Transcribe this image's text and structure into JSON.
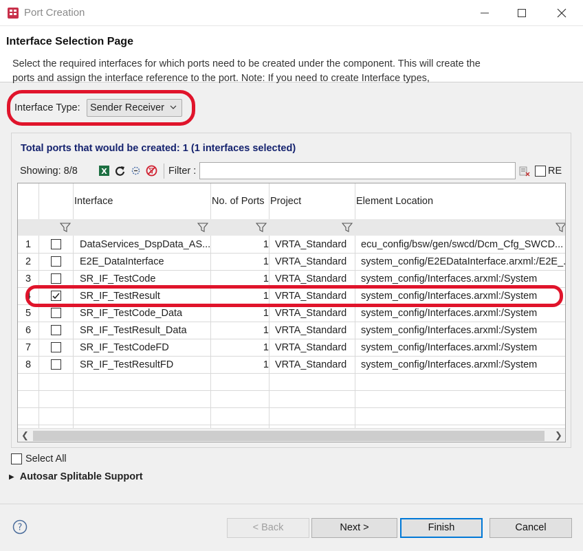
{
  "window": {
    "title": "Port Creation"
  },
  "page": {
    "title": "Interface Selection Page",
    "description": "Select the required interfaces for which ports need to be created under the component. This will create the ports and assign the interface reference to the port. Note: If you need to create Interface types,"
  },
  "interface_type": {
    "label": "Interface Type:",
    "selected": "Sender Receiver"
  },
  "summary": {
    "total_ports": "Total ports that would be created: 1 (1 interfaces selected)"
  },
  "toolbar": {
    "showing": "Showing: 8/8",
    "filter_label": "Filter :",
    "filter_value": "",
    "re_label": "RE"
  },
  "table": {
    "columns": [
      "Interface",
      "No. of Ports",
      "Project",
      "Element Location"
    ],
    "rows": [
      {
        "num": "1",
        "checked": false,
        "interface": "DataServices_DspData_AS...",
        "ports": "1",
        "project": "VRTA_Standard",
        "location": "ecu_config/bsw/gen/swcd/Dcm_Cfg_SWCD..."
      },
      {
        "num": "2",
        "checked": false,
        "interface": "E2E_DataInterface",
        "ports": "1",
        "project": "VRTA_Standard",
        "location": "system_config/E2EDataInterface.arxml:/E2E_..."
      },
      {
        "num": "3",
        "checked": false,
        "interface": "SR_IF_TestCode",
        "ports": "1",
        "project": "VRTA_Standard",
        "location": "system_config/Interfaces.arxml:/System"
      },
      {
        "num": "4",
        "checked": true,
        "interface": "SR_IF_TestResult",
        "ports": "1",
        "project": "VRTA_Standard",
        "location": "system_config/Interfaces.arxml:/System"
      },
      {
        "num": "5",
        "checked": false,
        "interface": "SR_IF_TestCode_Data",
        "ports": "1",
        "project": "VRTA_Standard",
        "location": "system_config/Interfaces.arxml:/System"
      },
      {
        "num": "6",
        "checked": false,
        "interface": "SR_IF_TestResult_Data",
        "ports": "1",
        "project": "VRTA_Standard",
        "location": "system_config/Interfaces.arxml:/System"
      },
      {
        "num": "7",
        "checked": false,
        "interface": "SR_IF_TestCodeFD",
        "ports": "1",
        "project": "VRTA_Standard",
        "location": "system_config/Interfaces.arxml:/System"
      },
      {
        "num": "8",
        "checked": false,
        "interface": "SR_IF_TestResultFD",
        "ports": "1",
        "project": "VRTA_Standard",
        "location": "system_config/Interfaces.arxml:/System"
      }
    ]
  },
  "select_all": {
    "label": "Select All",
    "checked": false
  },
  "section": {
    "splitable": "Autosar Splitable Support"
  },
  "buttons": {
    "back": "< Back",
    "next": "Next >",
    "finish": "Finish",
    "cancel": "Cancel"
  },
  "colors": {
    "highlight_red": "#e0142b",
    "summary_text": "#14226e",
    "focus_blue": "#0078d7"
  }
}
